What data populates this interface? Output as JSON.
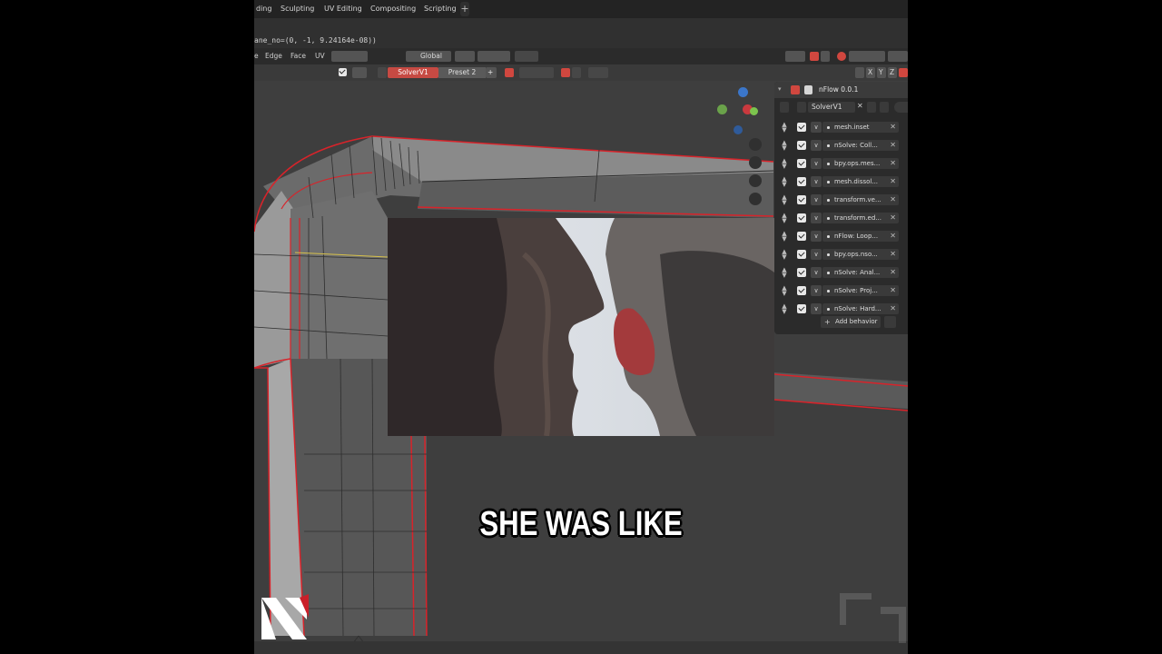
{
  "workspace_tabs": [
    "ding",
    "Sculpting",
    "UV Editing",
    "Compositing",
    "Scripting"
  ],
  "add_tab_label": "+",
  "console_line": "ane_no=(0, -1, 9.24164e-08))",
  "viewport_header": {
    "menus": [
      "e",
      "Edge",
      "Face",
      "UV"
    ],
    "orientation": "Global"
  },
  "solver_bar": {
    "active_solver": "SolverV1",
    "preset": "Preset 2",
    "add_label": "+"
  },
  "axis_buttons": [
    "X",
    "Y",
    "Z"
  ],
  "nflow_panel": {
    "title": "nFlow 0.0.1",
    "solver_name": "SolverV1",
    "behaviors": [
      "mesh.inset",
      "nSolve: Coll...",
      "bpy.ops.mes...",
      "mesh.dissol...",
      "transform.ve...",
      "transform.ed...",
      "nFlow: Loop...",
      "bpy.ops.nso...",
      "nSolve: Anal...",
      "nSolve: Proj...",
      "nSolve: Hard..."
    ],
    "add_behavior_label": "Add behavior"
  },
  "subtitle": "SHE WAS LIKE",
  "colors": {
    "accent_red": "#c64a43",
    "mesh_edge_red": "#d8232a",
    "viewport_bg": "#3d3d3d"
  },
  "icons": [
    "plus-icon",
    "checkbox-icon",
    "zoom-icon",
    "hand-icon",
    "camera-icon",
    "grid-icon",
    "close-icon",
    "filter-icon",
    "drag-handle-icon",
    "chevron-down-icon"
  ]
}
